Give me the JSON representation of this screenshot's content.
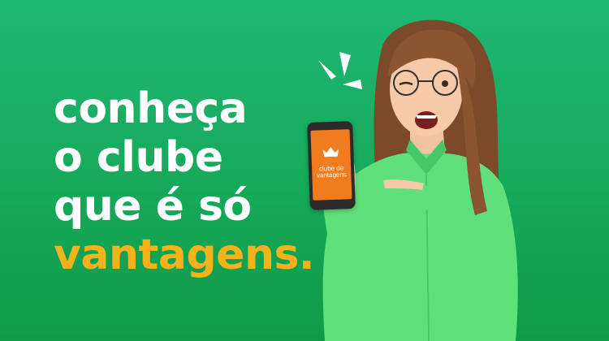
{
  "headline": {
    "line1": "conheça",
    "line2": "o clube",
    "line3": "que é só",
    "line4": "vantagens."
  },
  "phone_screen": {
    "label_line1": "clube de",
    "label_line2": "vantagens",
    "icon": "crown-icon"
  },
  "colors": {
    "background": "#16a95a",
    "headline": "#ffffff",
    "accent": "#f6b21b",
    "phone_screen": "#f07c1e",
    "shirt": "#5fe07a"
  }
}
